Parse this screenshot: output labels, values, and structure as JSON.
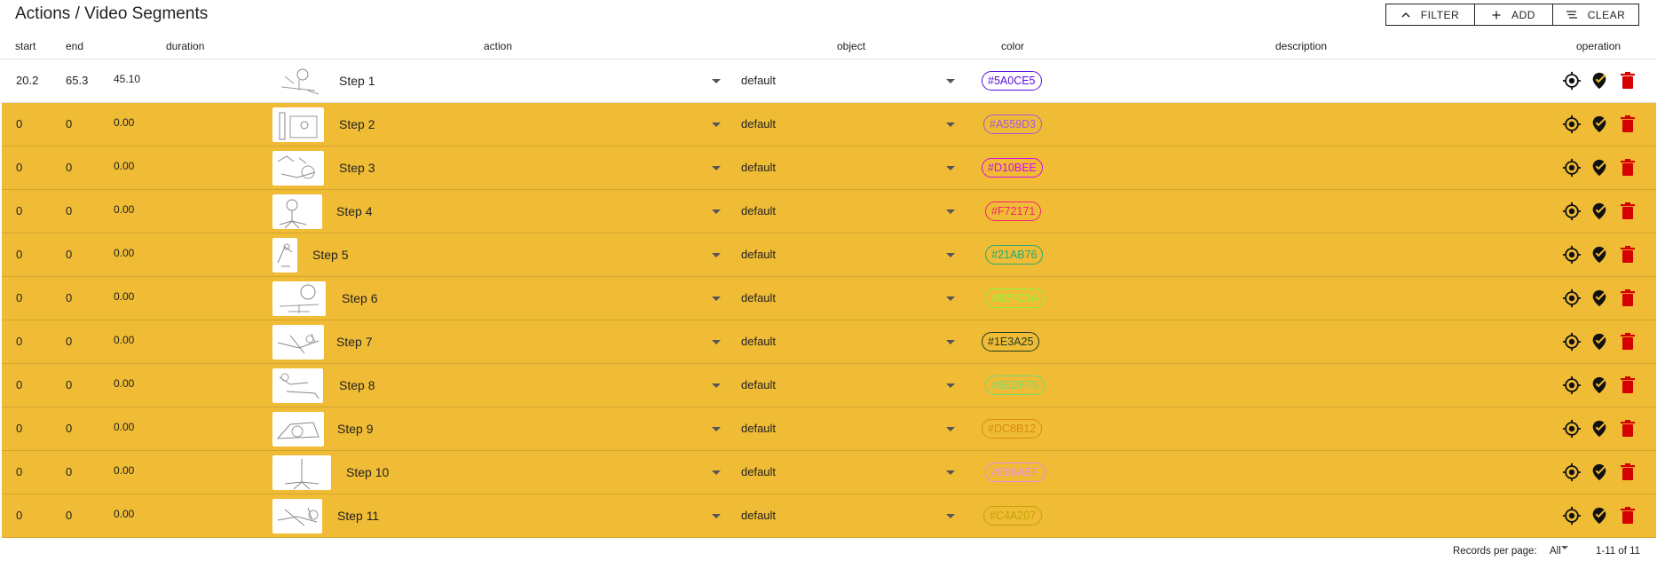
{
  "page": {
    "title": "Actions / Video Segments"
  },
  "toolbar": {
    "filter_label": "FILTER",
    "add_label": "ADD",
    "clear_label": "CLEAR"
  },
  "columns": {
    "start": "start",
    "end": "end",
    "duration": "duration",
    "action": "action",
    "object": "object",
    "color": "color",
    "description": "description",
    "operation": "operation"
  },
  "rows": [
    {
      "start": "20.2",
      "end": "65.3",
      "duration": "45.10",
      "action": "Step 1",
      "object": "default",
      "color": "#5A0CE5",
      "highlighted": false
    },
    {
      "start": "0",
      "end": "0",
      "duration": "0.00",
      "action": "Step 2",
      "object": "default",
      "color": "#A559D3",
      "highlighted": true
    },
    {
      "start": "0",
      "end": "0",
      "duration": "0.00",
      "action": "Step 3",
      "object": "default",
      "color": "#D10BEE",
      "highlighted": true
    },
    {
      "start": "0",
      "end": "0",
      "duration": "0.00",
      "action": "Step 4",
      "object": "default",
      "color": "#F72171",
      "highlighted": true
    },
    {
      "start": "0",
      "end": "0",
      "duration": "0.00",
      "action": "Step 5",
      "object": "default",
      "color": "#21AB76",
      "highlighted": true
    },
    {
      "start": "0",
      "end": "0",
      "duration": "0.00",
      "action": "Step 6",
      "object": "default",
      "color": "#82FC3A",
      "highlighted": true
    },
    {
      "start": "0",
      "end": "0",
      "duration": "0.00",
      "action": "Step 7",
      "object": "default",
      "color": "#1E3A25",
      "highlighted": true
    },
    {
      "start": "0",
      "end": "0",
      "duration": "0.00",
      "action": "Step 8",
      "object": "default",
      "color": "#6EDF75",
      "highlighted": true
    },
    {
      "start": "0",
      "end": "0",
      "duration": "0.00",
      "action": "Step 9",
      "object": "default",
      "color": "#DC8B12",
      "highlighted": true
    },
    {
      "start": "0",
      "end": "0",
      "duration": "0.00",
      "action": "Step 10",
      "object": "default",
      "color": "#E88AEF",
      "highlighted": true
    },
    {
      "start": "0",
      "end": "0",
      "duration": "0.00",
      "action": "Step 11",
      "object": "default",
      "color": "#C4A207",
      "highlighted": true
    }
  ],
  "footer": {
    "records_label": "Records per page:",
    "records_value": "All",
    "range": "1-11 of 11"
  },
  "colors": {
    "highlight": "#F0BC35",
    "delete": "#D50000",
    "text": "#222222"
  },
  "icons": {
    "filter": "chevron-up-icon",
    "add": "plus-icon",
    "clear": "clear-all-icon",
    "locate": "crosshairs-gps-icon",
    "mark": "map-marker-check-icon",
    "delete": "trash-can-icon"
  }
}
